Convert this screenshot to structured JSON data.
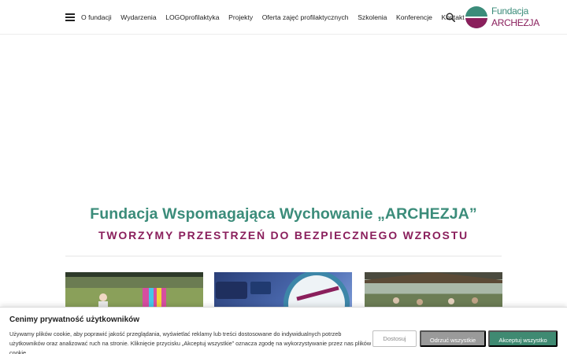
{
  "header": {
    "nav": [
      "O fundacji",
      "Wydarzenia",
      "LOGOprofilaktyka",
      "Projekty",
      "Oferta zajęć profilaktycznych",
      "Szkolenia",
      "Konferencje",
      "Kontakt"
    ],
    "logo": {
      "line1": "Fundacja",
      "line2": "ARCHEZJA"
    }
  },
  "hero": {
    "title": "Fundacja Wspomagająca Wychowanie „ARCHEZJA”",
    "subtitle": "TWORZYMY PRZESTRZEŃ DO BEZPIECZNEGO WZROSTU"
  },
  "cookie": {
    "title": "Cenimy prywatność użytkowników",
    "text": "Używamy plików cookie, aby poprawić jakość przeglądania, wyświetlać reklamy lub treści dostosowane do indywidualnych potrzeb użytkowników oraz analizować ruch na stronie. Kliknięcie przycisku „Akceptuj wszystkie” oznacza zgodę na wykorzystywanie przez nas plików cookie.",
    "customize_label": "Dostosuj",
    "reject_label": "Odrzuć wszystkie",
    "accept_label": "Akceptuj wszystko"
  },
  "colors": {
    "brand_green": "#3b8c7a",
    "brand_purple": "#8a1f5c",
    "accept_button": "#3f8a72"
  }
}
